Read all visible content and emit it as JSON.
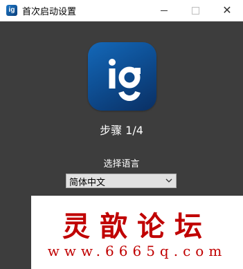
{
  "window": {
    "title": "首次启动设置",
    "icon": "ig-app-icon",
    "controls": [
      "minimize-icon",
      "maximize-icon",
      "close-icon"
    ],
    "close_glyph": "✕"
  },
  "setup": {
    "step": "步骤 1/4",
    "language_label": "选择语言",
    "language_selected": "简体中文"
  },
  "logo": {
    "text": "ig",
    "colors": [
      "#1468b8",
      "#0a2f63"
    ]
  },
  "watermark": {
    "title": "灵歆论坛",
    "url": "www.6665q.com",
    "color": "#c00000"
  },
  "colors": {
    "background": "#3d3d3d",
    "titlebar": "#ffffff",
    "text": "#ffffff"
  }
}
